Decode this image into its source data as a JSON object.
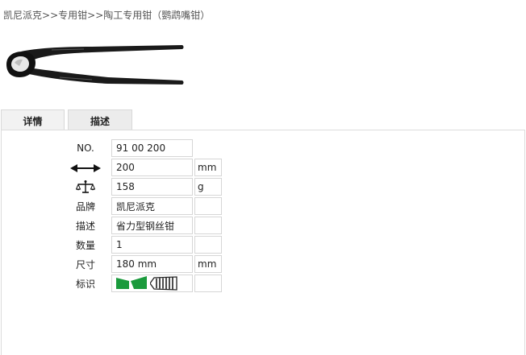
{
  "breadcrumb": {
    "items": [
      "凯尼派克",
      "专用钳",
      "陶工专用钳（鹦鹉嘴钳）"
    ],
    "separator": ">>"
  },
  "tabs": [
    {
      "label": "详情",
      "active": true
    },
    {
      "label": "描述",
      "active": false
    }
  ],
  "specs": {
    "no_label": "NO.",
    "no_value": "91 00 200",
    "length_icon": "double-arrow-length-icon",
    "length_value": "200",
    "length_unit": "mm",
    "weight_icon": "balance-scale-icon",
    "weight_value": "158",
    "weight_unit": "g",
    "brand_label": "品牌",
    "brand_value": "凯尼派克",
    "desc_label": "描述",
    "desc_value": "省力型钢丝钳",
    "qty_label": "数量",
    "qty_value": "1",
    "size_label": "尺寸",
    "size_value": "180 mm",
    "size_unit": "mm",
    "mark_label": "标识",
    "mark_icons": [
      "green-jaw-mark-icon",
      "grip-pattern-icon"
    ]
  },
  "colors": {
    "mark_green": "#1a9a3c",
    "tab_bg": "#ececec",
    "border": "#d6d6d6"
  }
}
